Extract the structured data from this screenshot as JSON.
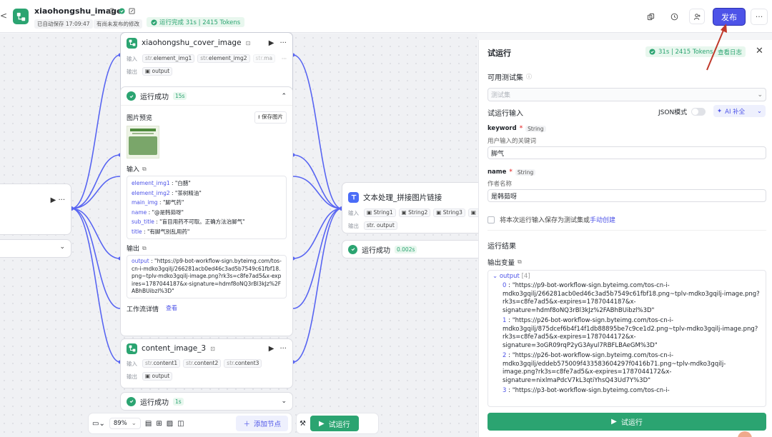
{
  "header": {
    "back": "<",
    "app_title": "xiaohongshu_image",
    "autosave": "已自动保存 17:09:47",
    "unpublished": "有尚未发布的修改",
    "run_status": "运行完成 31s | 2415 Tokens",
    "publish_label": "发布",
    "more": "···"
  },
  "canvas": {
    "left_node": {
      "actions": "▶  ···"
    },
    "cover_node": {
      "title": "xiaohongshu_cover_image",
      "input_label": "输入",
      "output_label": "输出",
      "inputs": [
        {
          "type": "str.",
          "name": "element_img1"
        },
        {
          "type": "str.",
          "name": "element_img2"
        },
        {
          "type": "str.",
          "name": "ma"
        }
      ],
      "output": "output"
    },
    "cover_result": {
      "status": "运行成功",
      "time": "15s",
      "preview_label": "图片预览",
      "save_image": "保存图片",
      "input_label": "输入",
      "inputs": [
        {
          "key": "element_img1",
          "value": "\"白醋\""
        },
        {
          "key": "element_img2",
          "value": "\"茶树精油\""
        },
        {
          "key": "main_img",
          "value": "\"脚气药\""
        },
        {
          "key": "name",
          "value": "\"@是韩茹呀\""
        },
        {
          "key": "sub_title",
          "value": "\"盲目用药不可取。正确方法治脚气\""
        },
        {
          "key": "title",
          "value": "\"有脚气别乱用药\""
        }
      ],
      "output_label": "输出",
      "output_key": "output",
      "output_value": "\"https://p9-bot-workflow-sign.byteimg.com/tos-cn-i-mdko3gqilj/266281acb0ed46c3ad5b7549c61fbf18.png~tplv-mdko3gqilj-image.png?rk3s=c8fe7ad5&x-expires=1787044187&x-signature=hdmf8oNQ3rBl3kJz%2FABhBUibzl%3D\"",
      "workflow_detail": "工作流详情",
      "view": "查看"
    },
    "content3_node": {
      "title": "content_image_3",
      "input_label": "输入",
      "output_label": "输出",
      "inputs": [
        {
          "type": "str.",
          "name": "content1"
        },
        {
          "type": "str.",
          "name": "content2"
        },
        {
          "type": "str.",
          "name": "content3"
        }
      ],
      "output": "output"
    },
    "content3_result": {
      "status": "运行成功",
      "time": "1s"
    },
    "text_node": {
      "title": "文本处理_拼接图片链接",
      "input_label": "输入",
      "output_label": "输出",
      "inputs": [
        "String1",
        "String2",
        "String3",
        "S"
      ],
      "output": "output"
    },
    "text_result": {
      "status": "运行成功",
      "time": "0.002s"
    },
    "toolbar": {
      "zoom": "89%",
      "add_node": "添加节点",
      "run": "试运行"
    }
  },
  "panel": {
    "title": "试运行",
    "run_tag": "31s | 2415 Tokens",
    "view_log": "查看日志",
    "testset_label": "可用测试集",
    "testset_placeholder": "测试集",
    "run_input_label": "试运行输入",
    "json_mode": "JSON模式",
    "ai_fill": "AI 补全",
    "fields": [
      {
        "name": "keyword",
        "type": "String",
        "desc": "用户输入的关键词",
        "value": "脚气"
      },
      {
        "name": "name",
        "type": "String",
        "desc": "作者名称",
        "value": "是韩茹呀"
      }
    ],
    "save_testset": "将本次运行输入保存为测试集或",
    "manual_create": "手动创建",
    "result_label": "运行结果",
    "output_vars": "输出变量",
    "output_key": "output",
    "output_count": "[4]",
    "outputs": [
      {
        "idx": "0",
        "value": "\"https://p9-bot-workflow-sign.byteimg.com/tos-cn-i-mdko3gqilj/266281acb0ed46c3ad5b7549c61fbf18.png~tplv-mdko3gqilj-image.png?rk3s=c8fe7ad5&x-expires=1787044187&x-signature=hdmf8oNQ3rBl3kJz%2FABhBUibzl%3D\""
      },
      {
        "idx": "1",
        "value": "\"https://p26-bot-workflow-sign.byteimg.com/tos-cn-i-mdko3gqilj/875dcef6b4f14f1db88895be7c9ce1d2.png~tplv-mdko3gqilj-image.png?rk3s=c8fe7ad5&x-expires=1787044172&x-signature=3oGR09rqP2yG3Ayul7RBFLBAeGM%3D\""
      },
      {
        "idx": "2",
        "value": "\"https://p26-bot-workflow-sign.byteimg.com/tos-cn-i-mdko3gqilj/eddeb575009f433583604297f0416b71.png~tplv-mdko3gqilj-image.png?rk3s=c8fe7ad5&x-expires=1787044172&x-signature=nixlmaPdcV7kL3qtiYhsQ43Ud7Y%3D\""
      },
      {
        "idx": "3",
        "value": "\"https://p3-bot-workflow-sign.byteimg.com/tos-cn-i-"
      }
    ],
    "run_button": "试运行"
  },
  "colors": {
    "accent": "#4d53e8",
    "success": "#2ba471",
    "annotation_arrow": "#c0392b"
  }
}
